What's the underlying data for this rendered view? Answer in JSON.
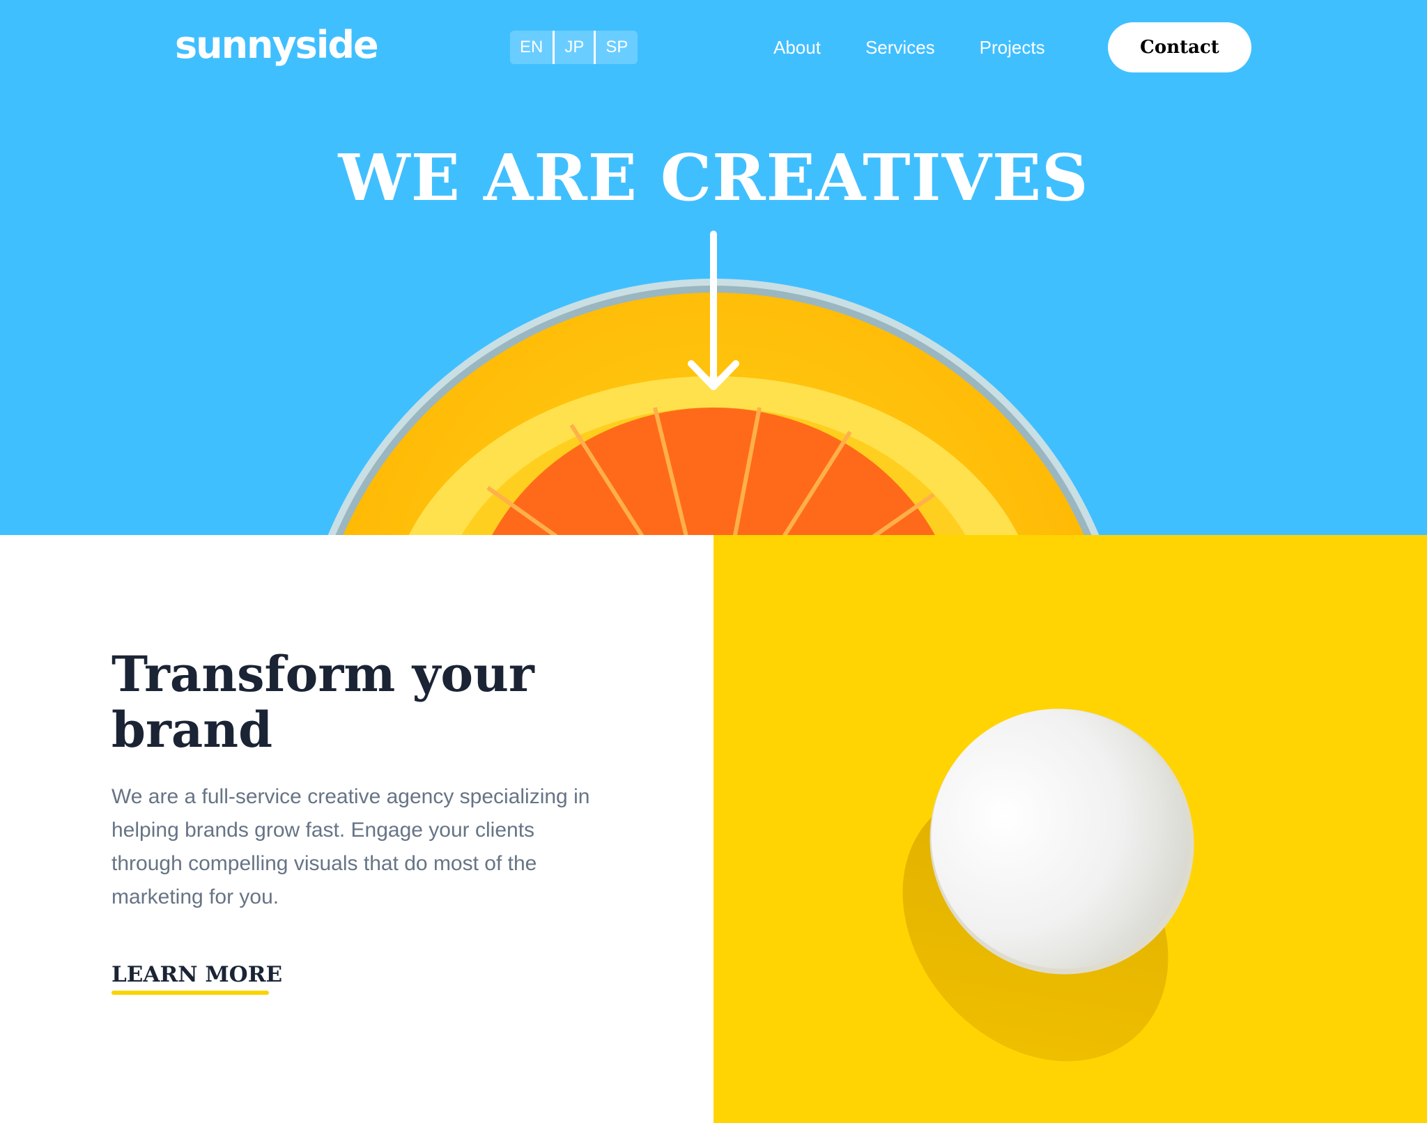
{
  "header": {
    "logo": "sunnyside",
    "languages": [
      "EN",
      "JP",
      "SP"
    ],
    "nav": [
      "About",
      "Services",
      "Projects"
    ],
    "contact_label": "Contact"
  },
  "hero": {
    "title": "WE ARE CREATIVES",
    "arrow_icon": "arrow-down-icon"
  },
  "feature": {
    "title": "Transform your brand",
    "body": "We are a full-service creative agency specializing in helping brands grow fast. Engage your clients through compelling visuals that do most of the marketing for you.",
    "link_label": "LEARN MORE"
  },
  "colors": {
    "hero_blue": "#40bfff",
    "accent_yellow": "#ffd402",
    "heading_dark": "#1b2435",
    "body_gray": "#667485"
  }
}
